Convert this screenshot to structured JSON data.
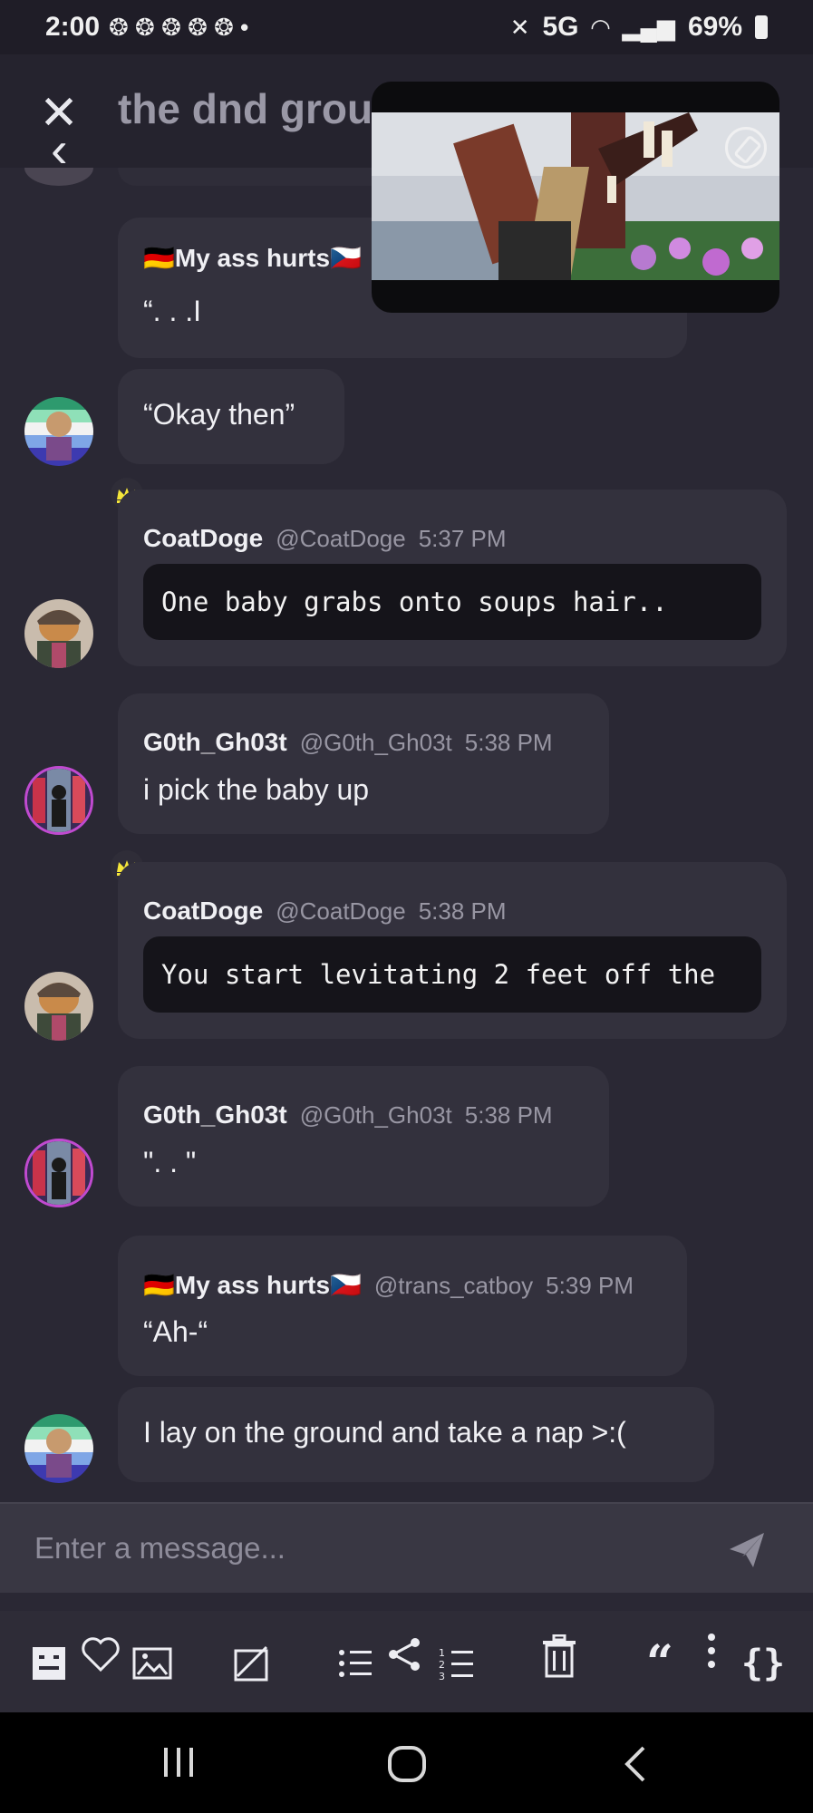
{
  "status_bar": {
    "time": "2:00",
    "notification_icons": "❂ ❂ ❂ ❂ ❂ •",
    "network": "5G",
    "battery": "69%"
  },
  "header": {
    "title": "the dnd group"
  },
  "messages": [
    {
      "author": "🇩🇪My ass hurts🇨🇿",
      "text": "“. . .I"
    },
    {
      "text": "“Okay then”"
    },
    {
      "author": "CoatDoge",
      "handle": "@CoatDoge",
      "time": "5:37 PM",
      "code": "One baby grabs onto soups hair.."
    },
    {
      "author": "G0th_Gh03t",
      "handle": "@G0th_Gh03t",
      "time": "5:38 PM",
      "text": "i pick the baby up"
    },
    {
      "author": "CoatDoge",
      "handle": "@CoatDoge",
      "time": "5:38 PM",
      "code": "You start levitating 2 feet off the"
    },
    {
      "author": "G0th_Gh03t",
      "handle": "@G0th_Gh03t",
      "time": "5:38 PM",
      "text": "\". . \""
    },
    {
      "author": "🇩🇪My ass hurts🇨🇿",
      "handle": "@trans_catboy",
      "time": "5:39 PM",
      "text": "“Ah-“"
    },
    {
      "text": "I lay on the ground and take a nap >:("
    }
  ],
  "composer": {
    "placeholder": "Enter a message..."
  },
  "toolbar": {
    "items": [
      "spoiler-icon",
      "heart-icon",
      "image-icon",
      "gif-icon",
      "bullet-list-icon",
      "share-icon",
      "numbered-list-icon",
      "trash-icon",
      "quote-icon",
      "more-icon",
      "code-braces-icon"
    ]
  },
  "colors": {
    "background": "#2a2834",
    "bubble": "#33313d",
    "code_block": "#15141a",
    "crown": "#f5e63a"
  }
}
